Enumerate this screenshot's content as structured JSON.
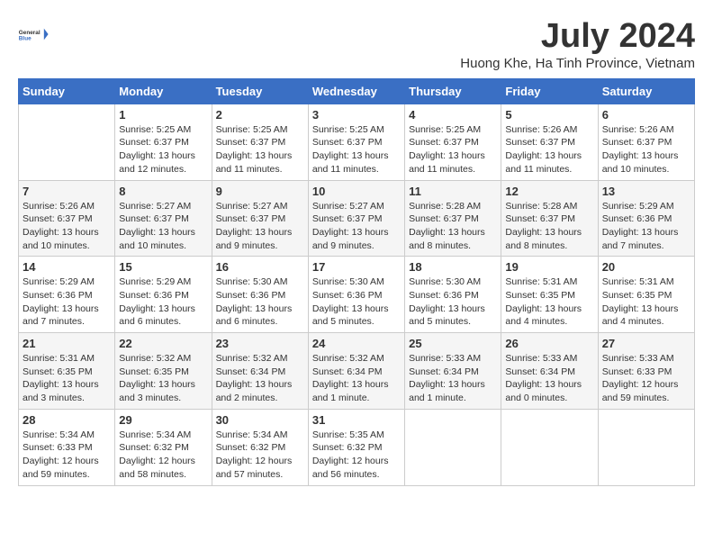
{
  "header": {
    "logo_line1": "General",
    "logo_line2": "Blue",
    "month": "July 2024",
    "location": "Huong Khe, Ha Tinh Province, Vietnam"
  },
  "days_of_week": [
    "Sunday",
    "Monday",
    "Tuesday",
    "Wednesday",
    "Thursday",
    "Friday",
    "Saturday"
  ],
  "weeks": [
    [
      {
        "day": "",
        "info": ""
      },
      {
        "day": "1",
        "info": "Sunrise: 5:25 AM\nSunset: 6:37 PM\nDaylight: 13 hours\nand 12 minutes."
      },
      {
        "day": "2",
        "info": "Sunrise: 5:25 AM\nSunset: 6:37 PM\nDaylight: 13 hours\nand 11 minutes."
      },
      {
        "day": "3",
        "info": "Sunrise: 5:25 AM\nSunset: 6:37 PM\nDaylight: 13 hours\nand 11 minutes."
      },
      {
        "day": "4",
        "info": "Sunrise: 5:25 AM\nSunset: 6:37 PM\nDaylight: 13 hours\nand 11 minutes."
      },
      {
        "day": "5",
        "info": "Sunrise: 5:26 AM\nSunset: 6:37 PM\nDaylight: 13 hours\nand 11 minutes."
      },
      {
        "day": "6",
        "info": "Sunrise: 5:26 AM\nSunset: 6:37 PM\nDaylight: 13 hours\nand 10 minutes."
      }
    ],
    [
      {
        "day": "7",
        "info": "Sunrise: 5:26 AM\nSunset: 6:37 PM\nDaylight: 13 hours\nand 10 minutes."
      },
      {
        "day": "8",
        "info": "Sunrise: 5:27 AM\nSunset: 6:37 PM\nDaylight: 13 hours\nand 10 minutes."
      },
      {
        "day": "9",
        "info": "Sunrise: 5:27 AM\nSunset: 6:37 PM\nDaylight: 13 hours\nand 9 minutes."
      },
      {
        "day": "10",
        "info": "Sunrise: 5:27 AM\nSunset: 6:37 PM\nDaylight: 13 hours\nand 9 minutes."
      },
      {
        "day": "11",
        "info": "Sunrise: 5:28 AM\nSunset: 6:37 PM\nDaylight: 13 hours\nand 8 minutes."
      },
      {
        "day": "12",
        "info": "Sunrise: 5:28 AM\nSunset: 6:37 PM\nDaylight: 13 hours\nand 8 minutes."
      },
      {
        "day": "13",
        "info": "Sunrise: 5:29 AM\nSunset: 6:36 PM\nDaylight: 13 hours\nand 7 minutes."
      }
    ],
    [
      {
        "day": "14",
        "info": "Sunrise: 5:29 AM\nSunset: 6:36 PM\nDaylight: 13 hours\nand 7 minutes."
      },
      {
        "day": "15",
        "info": "Sunrise: 5:29 AM\nSunset: 6:36 PM\nDaylight: 13 hours\nand 6 minutes."
      },
      {
        "day": "16",
        "info": "Sunrise: 5:30 AM\nSunset: 6:36 PM\nDaylight: 13 hours\nand 6 minutes."
      },
      {
        "day": "17",
        "info": "Sunrise: 5:30 AM\nSunset: 6:36 PM\nDaylight: 13 hours\nand 5 minutes."
      },
      {
        "day": "18",
        "info": "Sunrise: 5:30 AM\nSunset: 6:36 PM\nDaylight: 13 hours\nand 5 minutes."
      },
      {
        "day": "19",
        "info": "Sunrise: 5:31 AM\nSunset: 6:35 PM\nDaylight: 13 hours\nand 4 minutes."
      },
      {
        "day": "20",
        "info": "Sunrise: 5:31 AM\nSunset: 6:35 PM\nDaylight: 13 hours\nand 4 minutes."
      }
    ],
    [
      {
        "day": "21",
        "info": "Sunrise: 5:31 AM\nSunset: 6:35 PM\nDaylight: 13 hours\nand 3 minutes."
      },
      {
        "day": "22",
        "info": "Sunrise: 5:32 AM\nSunset: 6:35 PM\nDaylight: 13 hours\nand 3 minutes."
      },
      {
        "day": "23",
        "info": "Sunrise: 5:32 AM\nSunset: 6:34 PM\nDaylight: 13 hours\nand 2 minutes."
      },
      {
        "day": "24",
        "info": "Sunrise: 5:32 AM\nSunset: 6:34 PM\nDaylight: 13 hours\nand 1 minute."
      },
      {
        "day": "25",
        "info": "Sunrise: 5:33 AM\nSunset: 6:34 PM\nDaylight: 13 hours\nand 1 minute."
      },
      {
        "day": "26",
        "info": "Sunrise: 5:33 AM\nSunset: 6:34 PM\nDaylight: 13 hours\nand 0 minutes."
      },
      {
        "day": "27",
        "info": "Sunrise: 5:33 AM\nSunset: 6:33 PM\nDaylight: 12 hours\nand 59 minutes."
      }
    ],
    [
      {
        "day": "28",
        "info": "Sunrise: 5:34 AM\nSunset: 6:33 PM\nDaylight: 12 hours\nand 59 minutes."
      },
      {
        "day": "29",
        "info": "Sunrise: 5:34 AM\nSunset: 6:32 PM\nDaylight: 12 hours\nand 58 minutes."
      },
      {
        "day": "30",
        "info": "Sunrise: 5:34 AM\nSunset: 6:32 PM\nDaylight: 12 hours\nand 57 minutes."
      },
      {
        "day": "31",
        "info": "Sunrise: 5:35 AM\nSunset: 6:32 PM\nDaylight: 12 hours\nand 56 minutes."
      },
      {
        "day": "",
        "info": ""
      },
      {
        "day": "",
        "info": ""
      },
      {
        "day": "",
        "info": ""
      }
    ]
  ]
}
